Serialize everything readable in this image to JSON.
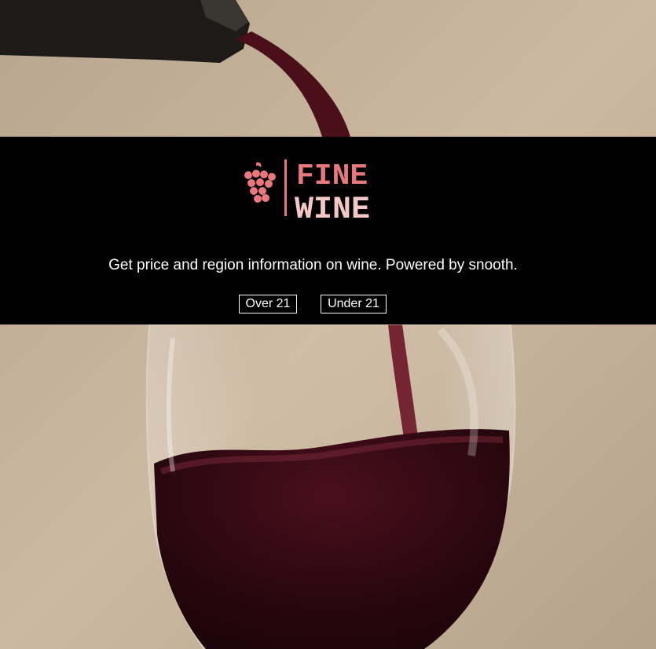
{
  "logo": {
    "line1": "FINE",
    "line2": "WINE",
    "icon": "grapes-icon"
  },
  "tagline": "Get price and region information on wine. Powered by snooth.",
  "buttons": {
    "over": "Over 21",
    "under": "Under 21"
  },
  "colors": {
    "banner": "#000000",
    "logo_top": "#e8787e",
    "logo_bottom": "#f3c8c6",
    "wine": "#3a0a14",
    "text": "#ffffff"
  }
}
